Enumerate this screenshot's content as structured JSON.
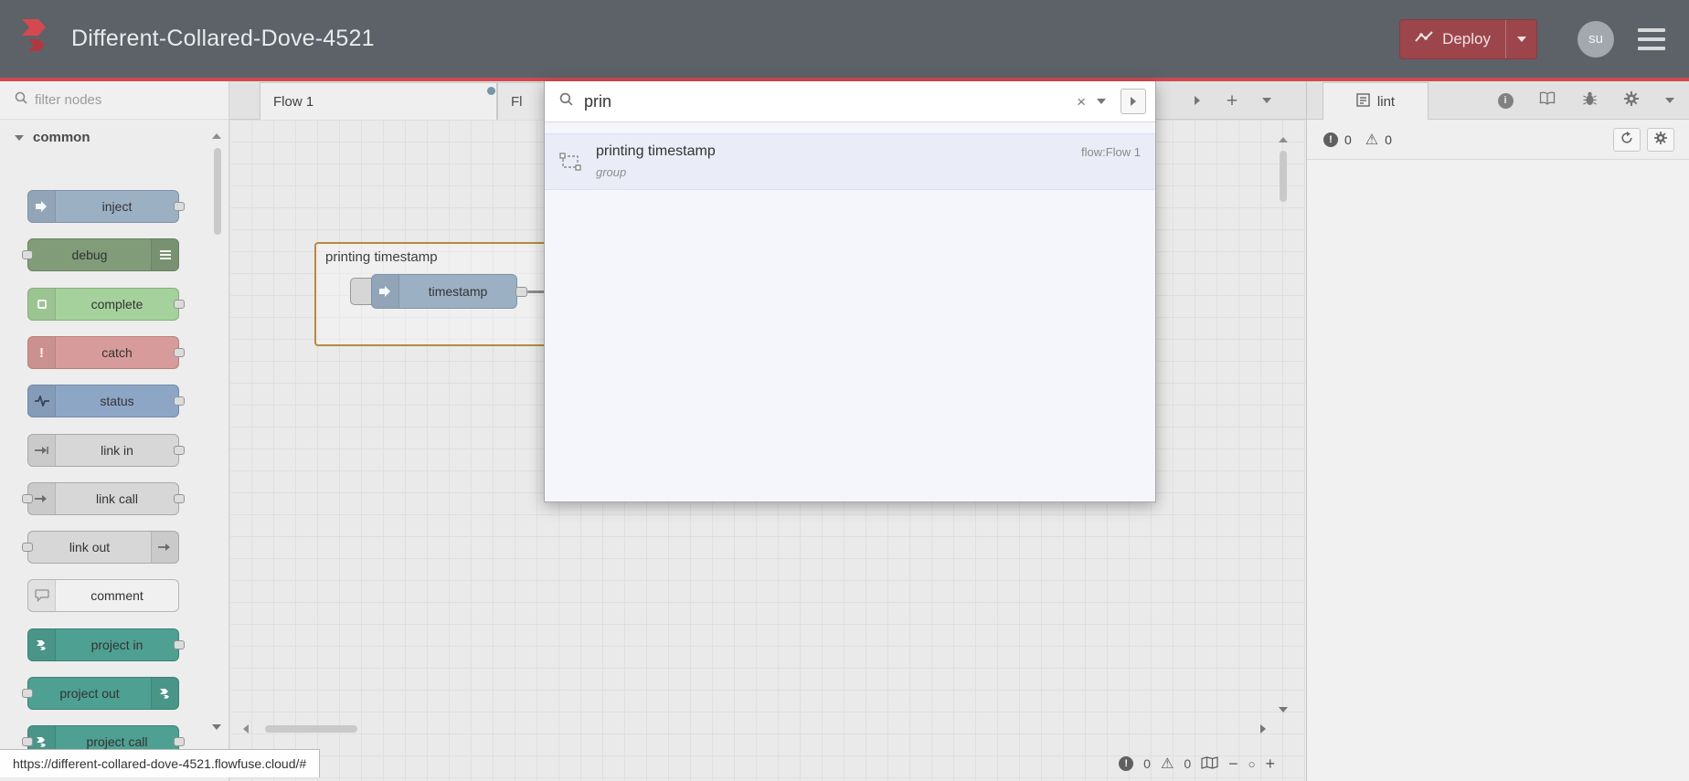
{
  "header": {
    "title": "Different-Collared-Dove-4521",
    "deploy": {
      "label": "Deploy"
    },
    "avatar": "su"
  },
  "palette": {
    "filter_placeholder": "filter nodes",
    "category": "common",
    "nodes": [
      {
        "label": "inject"
      },
      {
        "label": "debug"
      },
      {
        "label": "complete"
      },
      {
        "label": "catch"
      },
      {
        "label": "status"
      },
      {
        "label": "link in"
      },
      {
        "label": "link call"
      },
      {
        "label": "link out"
      },
      {
        "label": "comment"
      },
      {
        "label": "project in"
      },
      {
        "label": "project out"
      },
      {
        "label": "project call"
      }
    ]
  },
  "workspace": {
    "tabs": [
      {
        "label": "Flow 1"
      },
      {
        "label": "Fl"
      }
    ],
    "group": {
      "label": "printing timestamp",
      "node_label": "timestamp"
    }
  },
  "search": {
    "query": "prin",
    "results": [
      {
        "title": "printing timestamp",
        "subtitle": "group",
        "flow": "flow:Flow 1"
      }
    ]
  },
  "sidebar": {
    "tab_label": "lint",
    "error_count": "0",
    "warning_count": "0"
  },
  "footer": {
    "error_count": "0",
    "warning_count": "0",
    "zoom_out": "−",
    "zoom_reset": "○",
    "zoom_in": "+"
  },
  "status_bar": {
    "url": "https://different-collared-dove-4521.flowfuse.cloud/#"
  },
  "colors": {
    "brand_red": "#cf4b50",
    "header_bg": "#5c6268",
    "deploy_bg": "#9c464c",
    "group_border": "#b68a3e",
    "node_inject": "#9cb0c4",
    "node_debug": "#809c79",
    "node_complete": "#a5d19c",
    "node_catch": "#d89b9b",
    "node_status": "#8ea6c5",
    "node_link": "#d7d7d7",
    "node_comment": "#f0f0f0",
    "node_project": "#4ea092"
  }
}
